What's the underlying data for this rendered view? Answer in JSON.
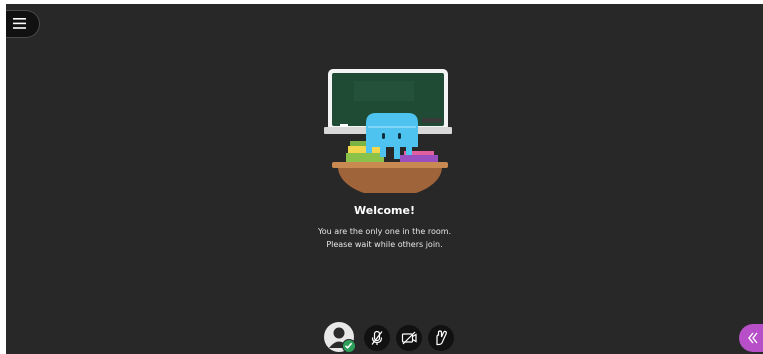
{
  "welcome": {
    "title": "Welcome!",
    "line1": "You are the only one in the room.",
    "line2": "Please wait while others join."
  },
  "icons": {
    "menu": "hamburger-menu-icon",
    "avatar": "user-avatar-icon",
    "status": "checkmark-icon",
    "mic": "microphone-muted-icon",
    "camera": "camera-off-icon",
    "hand": "raise-hand-icon",
    "collab_panel": "chevron-double-left-icon"
  },
  "colors": {
    "background": "#282828",
    "accent_purple": "#b64fc8",
    "status_green": "#2e9e5b",
    "chalkboard": "#1f4a34",
    "mascot": "#4fc3ef",
    "desk": "#a0643a"
  }
}
